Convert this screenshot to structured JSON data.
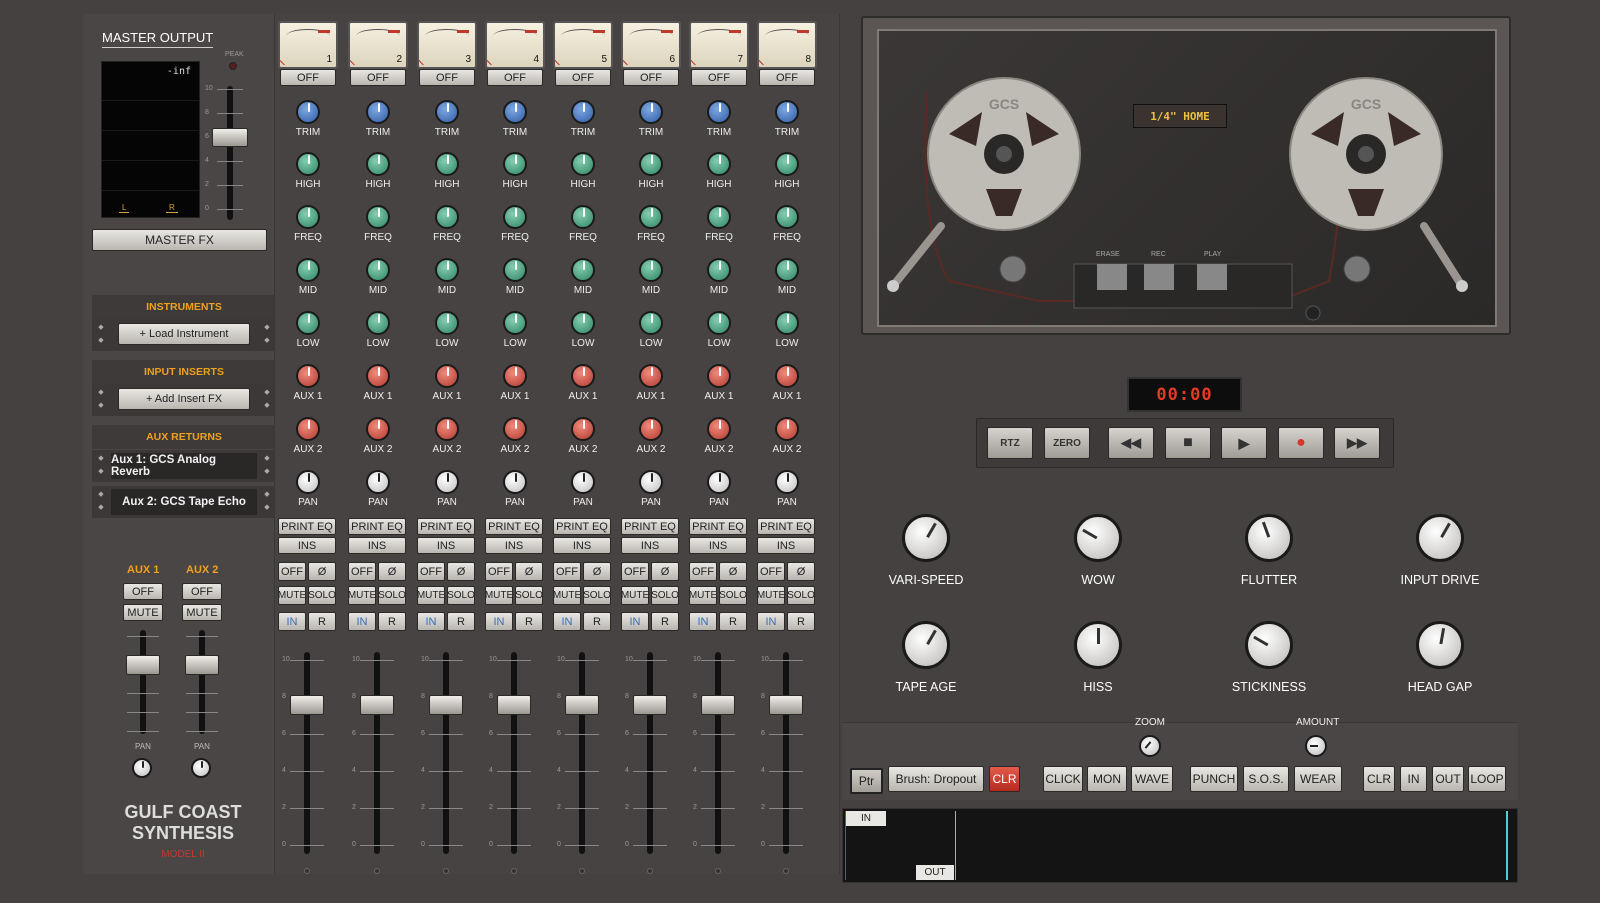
{
  "master": {
    "title": "MASTER OUTPUT",
    "peak_label": "PEAK",
    "readout": "-inf",
    "left_label": "L",
    "right_label": "R",
    "fx_button": "MASTER FX",
    "fader_level_fraction": 0.65,
    "scale_labels": [
      "10",
      "8",
      "6",
      "4",
      "2",
      "0"
    ]
  },
  "sections": {
    "instruments": "INSTRUMENTS",
    "load_instrument": "+ Load Instrument",
    "input_inserts": "INPUT INSERTS",
    "add_insert": "+ Add Insert FX",
    "aux_returns": "AUX RETURNS",
    "aux1_return": "Aux 1: GCS Analog Reverb",
    "aux2_return": "Aux 2: GCS Tape Echo"
  },
  "aux_strips": [
    {
      "label": "AUX 1",
      "power": "OFF",
      "mute": "MUTE",
      "pan_label": "PAN"
    },
    {
      "label": "AUX 2",
      "power": "OFF",
      "mute": "MUTE",
      "pan_label": "PAN"
    }
  ],
  "brand": {
    "line1": "GULF COAST",
    "line2": "SYNTHESIS",
    "model": "MODEL II"
  },
  "channel_labels": {
    "off": "OFF",
    "trim": "TRIM",
    "high": "HIGH",
    "freq": "FREQ",
    "mid": "MID",
    "low": "LOW",
    "aux1": "AUX 1",
    "aux2": "AUX 2",
    "pan": "PAN",
    "print_eq": "PRINT EQ",
    "ins": "INS",
    "phase": "Ø",
    "mute": "MUTE",
    "solo": "SOLO",
    "in": "IN",
    "rec": "R"
  },
  "channels": [
    {
      "number": "1"
    },
    {
      "number": "2"
    },
    {
      "number": "3"
    },
    {
      "number": "4"
    },
    {
      "number": "5"
    },
    {
      "number": "6"
    },
    {
      "number": "7"
    },
    {
      "number": "8"
    }
  ],
  "fader_scale": [
    "10",
    "8",
    "6",
    "4",
    "2",
    "0"
  ],
  "tape": {
    "reel_label": "1/4\" HOME",
    "erase": "ERASE",
    "rec": "REC",
    "play": "PLAY",
    "counter": "00:00"
  },
  "transport": {
    "rtz": "RTZ",
    "zero": "ZERO",
    "rewind": "◀◀",
    "stop": "■",
    "play": "▶",
    "record": "●",
    "ffwd": "▶▶"
  },
  "tape_knobs": [
    {
      "label": "VARI-SPEED"
    },
    {
      "label": "WOW"
    },
    {
      "label": "FLUTTER"
    },
    {
      "label": "INPUT DRIVE"
    },
    {
      "label": "TAPE AGE"
    },
    {
      "label": "HISS"
    },
    {
      "label": "STICKINESS"
    },
    {
      "label": "HEAD GAP"
    }
  ],
  "bottom": {
    "zoom": "ZOOM",
    "amount": "AMOUNT",
    "ptr": "Ptr",
    "brush": "Brush: Dropout",
    "clr_red": "CLR",
    "click": "CLICK",
    "mon": "MON",
    "wave": "WAVE",
    "punch": "PUNCH",
    "sos": "S.O.S.",
    "wear": "WEAR",
    "clr": "CLR",
    "in": "IN",
    "out": "OUT",
    "loop": "LOOP"
  },
  "timeline": {
    "in_marker": "IN",
    "out_marker": "OUT"
  },
  "colors": {
    "accent": "#f0a020",
    "record_red": "#d8362a",
    "counter_red": "#e23b24"
  }
}
